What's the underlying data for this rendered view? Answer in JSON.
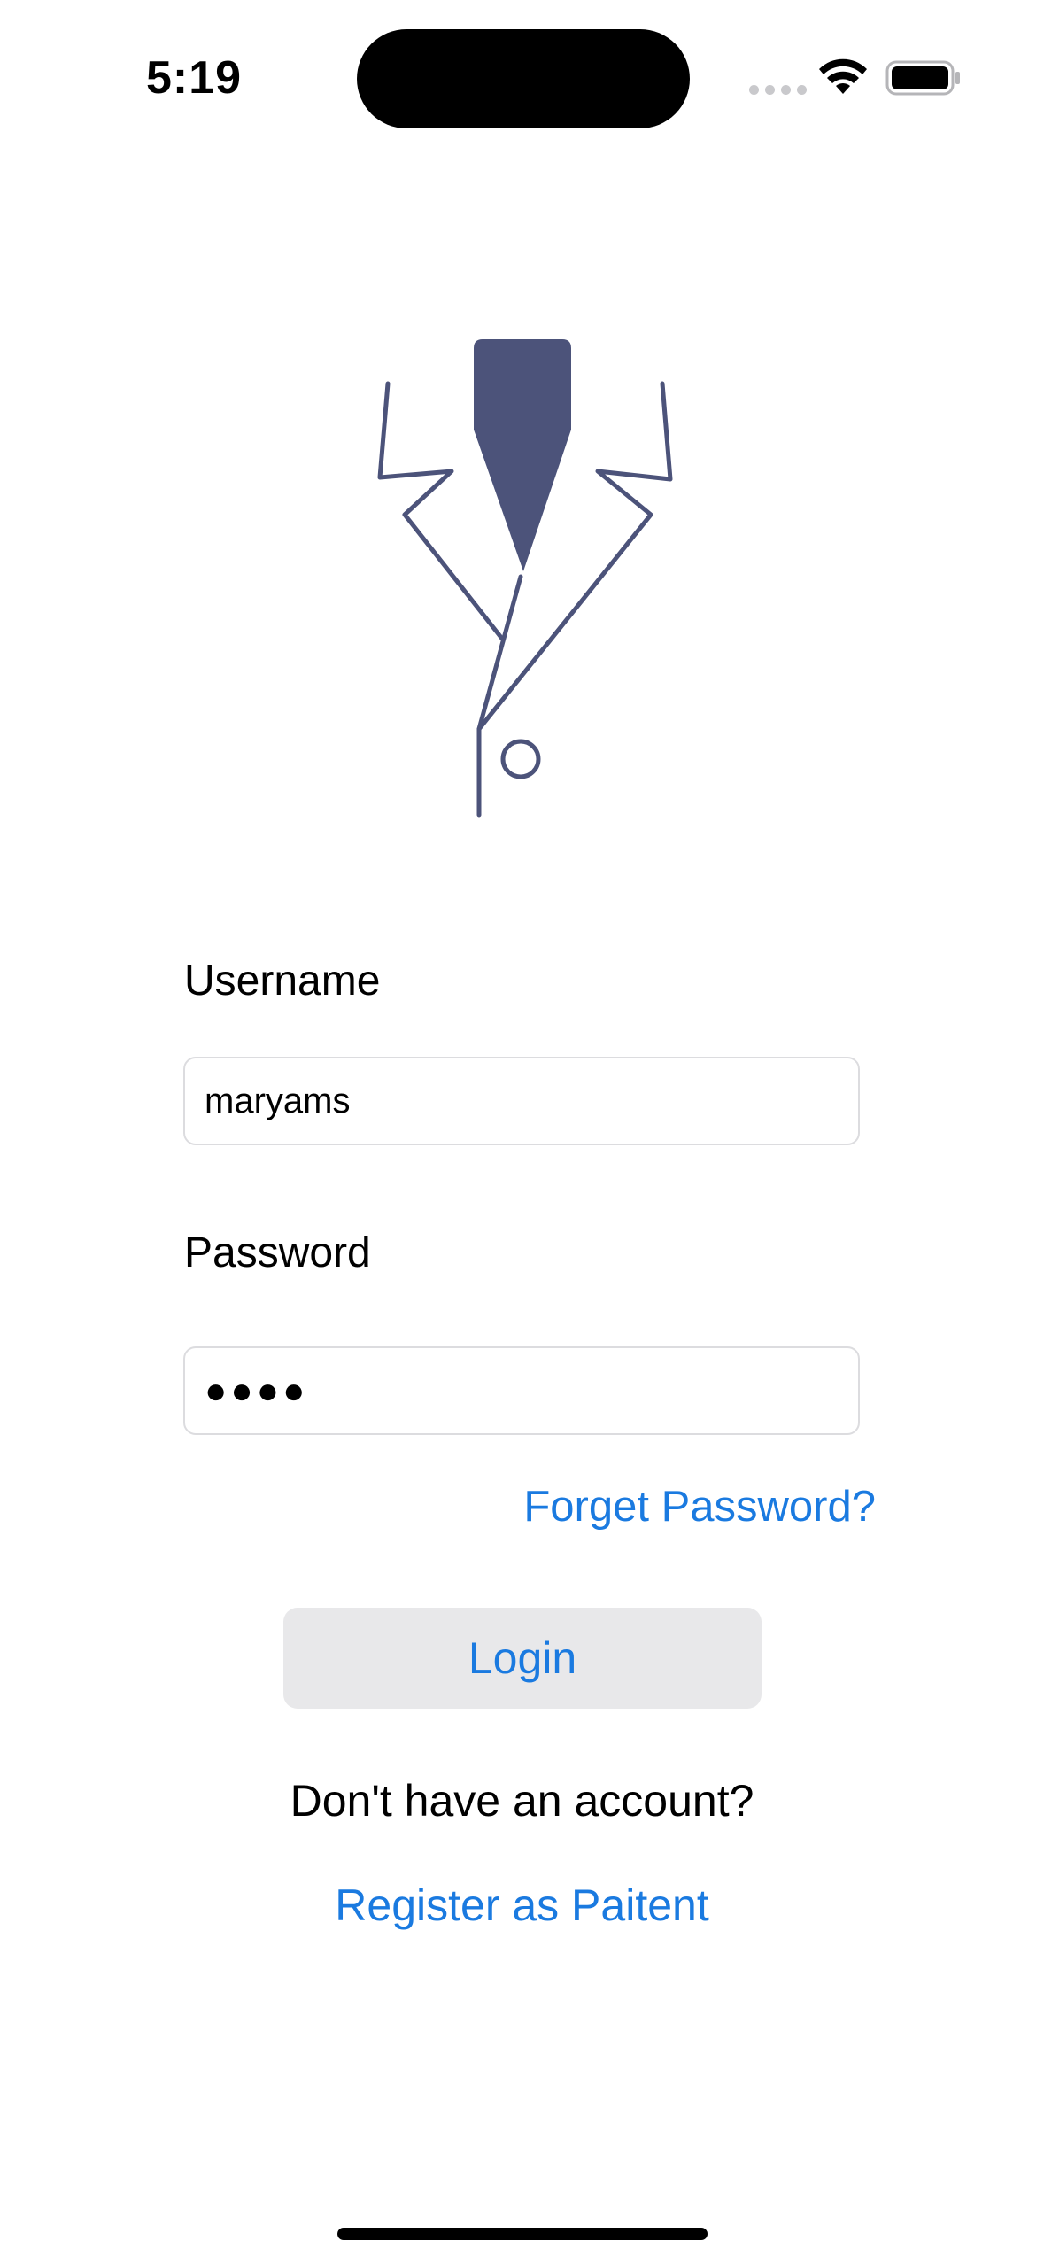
{
  "status_bar": {
    "time": "5:19",
    "icons": [
      "signal-dots-icon",
      "wifi-icon",
      "battery-icon"
    ]
  },
  "logo": {
    "icon": "doctor-suit-icon",
    "color": "#4c537a"
  },
  "form": {
    "username_label": "Username",
    "username_value": "maryams",
    "password_label": "Password",
    "password_value": "●●●●",
    "forgot_password": "Forget Password?",
    "login_label": "Login"
  },
  "footer": {
    "no_account_text": "Don't have an account?",
    "register_link": "Register as Paitent"
  },
  "colors": {
    "accent": "#1a7ae0",
    "button_bg": "#e8e8ea",
    "field_border": "#dcdcdf",
    "logo": "#4c537a"
  }
}
